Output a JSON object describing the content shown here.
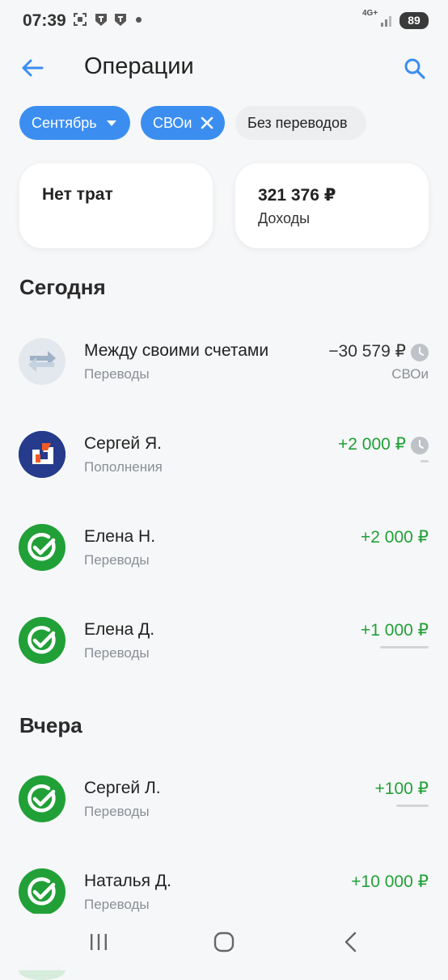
{
  "status_bar": {
    "time": "07:39",
    "network": "4G+",
    "battery": "89"
  },
  "header": {
    "title": "Операции"
  },
  "filters": {
    "month_chip": "Сентябрь",
    "account_chip": "СВОи",
    "no_transfers_chip": "Без переводов"
  },
  "summary": {
    "expenses_label": "Нет трат",
    "income_amount": "321 376 ₽",
    "income_label": "Доходы"
  },
  "sections": {
    "today": "Сегодня",
    "yesterday": "Вчера"
  },
  "transactions_today": [
    {
      "name": "Между своими счетами",
      "category": "Переводы",
      "amount": "−30 579 ₽",
      "account": "СВОи",
      "pending": true,
      "icon": "transfer-icon"
    },
    {
      "name": "Сергей Я.",
      "category": "Пополнения",
      "amount": "+2 000 ₽",
      "pending": true,
      "icon": "bank-logo-icon"
    },
    {
      "name": "Елена Н.",
      "category": "Переводы",
      "amount": "+2 000 ₽",
      "icon": "sber-check-icon"
    },
    {
      "name": "Елена Д.",
      "category": "Переводы",
      "amount": "+1 000 ₽",
      "icon": "sber-check-icon"
    }
  ],
  "transactions_yesterday": [
    {
      "name": "Сергей Л.",
      "category": "Переводы",
      "amount": "+100 ₽",
      "icon": "sber-check-icon"
    },
    {
      "name": "Наталья Д.",
      "category": "Переводы",
      "amount": "+10 000 ₽",
      "icon": "sber-check-icon"
    }
  ],
  "colors": {
    "accent": "#3b8ef0",
    "positive": "#21a038",
    "background": "#f6f7f8"
  },
  "navbar": {
    "icons": [
      "recent-apps-icon",
      "home-icon",
      "back-nav-icon"
    ]
  }
}
